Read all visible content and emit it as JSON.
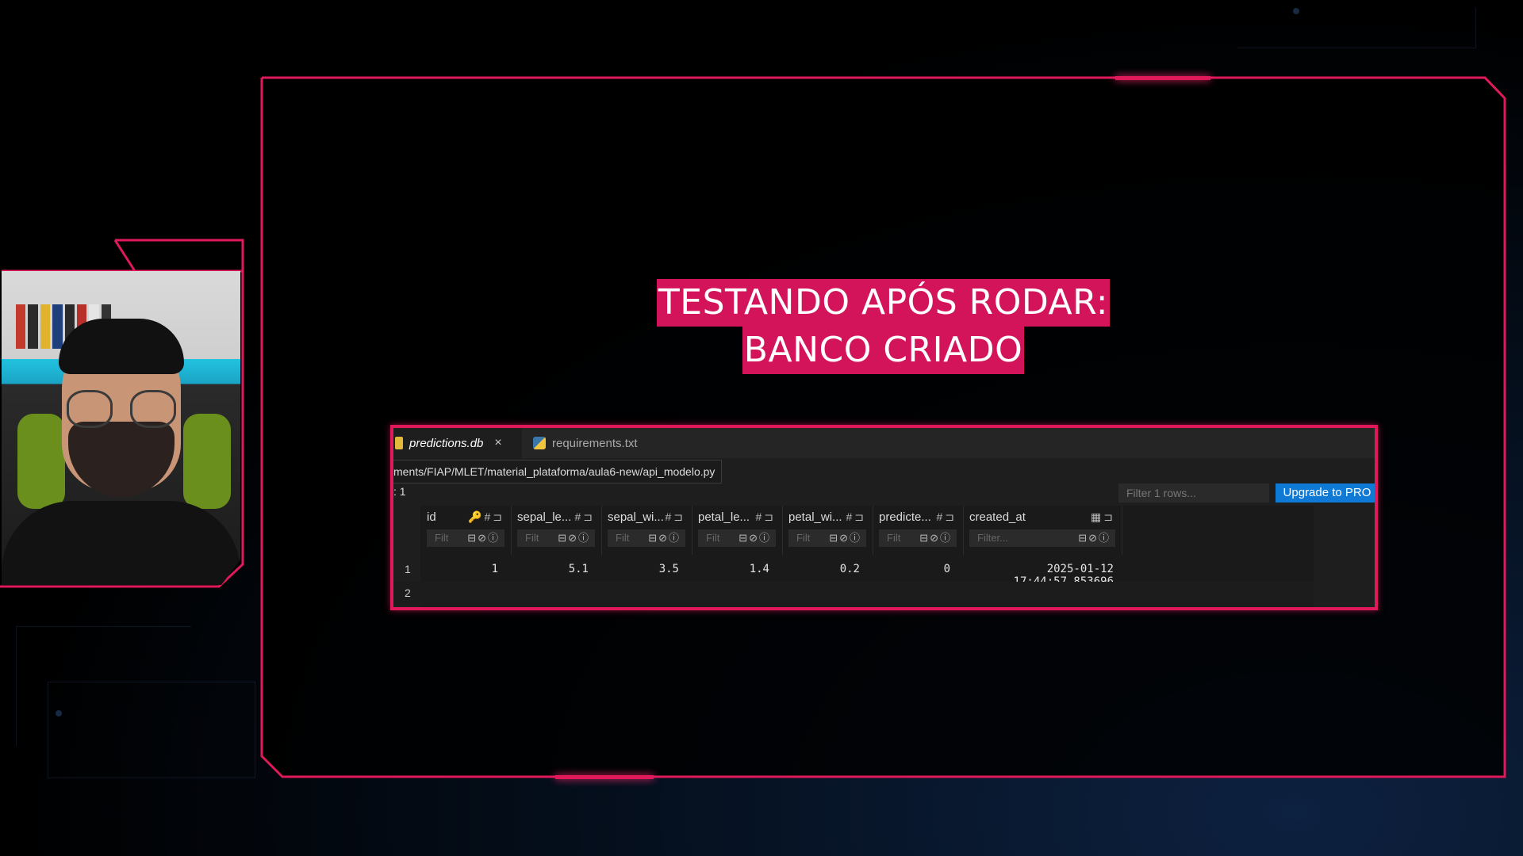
{
  "title": {
    "line1": "TESTANDO APÓS RODAR:",
    "line2": "BANCO CRIADO"
  },
  "colors": {
    "accent": "#e0195a",
    "title_bg": "#d4145a",
    "upgrade_button": "#0e7ad6"
  },
  "webcam": {
    "description_icon": "presenter-video"
  },
  "editor": {
    "tabs": [
      {
        "label": "predictions.db",
        "icon": "database-icon",
        "active": true,
        "close": "×"
      },
      {
        "label": "requirements.txt",
        "icon": "python-file-icon",
        "active": false
      }
    ],
    "path": "ments/FIAP/MLET/material_plataforma/aula6-new/api_modelo.py",
    "rows_label": ": 1",
    "filter_rows_placeholder": "Filter 1 rows...",
    "upgrade_label": "Upgrade to PRO",
    "columns": [
      {
        "name": "id",
        "icons": "🔑#⊐",
        "filter": "Filt"
      },
      {
        "name": "sepal_le...",
        "icons": "#⊐",
        "filter": "Filt"
      },
      {
        "name": "sepal_wi...",
        "icons": "#⊐",
        "filter": "Filt"
      },
      {
        "name": "petal_le...",
        "icons": "#⊐",
        "filter": "Filt"
      },
      {
        "name": "petal_wi...",
        "icons": "#⊐",
        "filter": "Filt"
      },
      {
        "name": "predicte...",
        "icons": "#⊐",
        "filter": "Filt"
      },
      {
        "name": "created_at",
        "icons": "▦⊐",
        "filter": "Filter..."
      }
    ],
    "filter_icons": "⊟⊘ⓘ",
    "rows": [
      {
        "num": "1",
        "cells": [
          "1",
          "5.1",
          "3.5",
          "1.4",
          "0.2",
          "0",
          "2025-01-12 17:44:57.853696"
        ]
      },
      {
        "num": "2",
        "cells": [
          "",
          "",
          "",
          "",
          "",
          "",
          ""
        ]
      }
    ]
  }
}
